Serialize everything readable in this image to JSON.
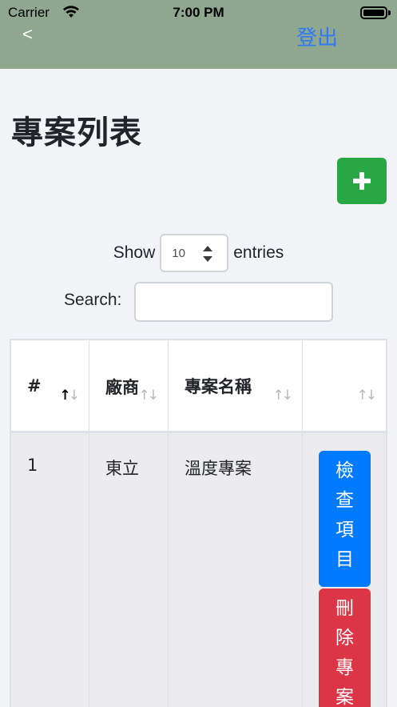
{
  "status_bar": {
    "carrier": "Carrier",
    "time": "7:00 PM"
  },
  "nav": {
    "back_label": "<",
    "logout_label": "登出"
  },
  "page": {
    "title": "專案列表"
  },
  "table_controls": {
    "show_label": "Show",
    "page_length": "10",
    "entries_label": "entries",
    "search_label": "Search:",
    "search_value": ""
  },
  "table": {
    "headers": [
      "#",
      "廠商",
      "專案名稱",
      ""
    ],
    "sort_symbol": "↑↓",
    "rows": [
      {
        "index": "1",
        "vendor": "東立",
        "project_name": "溫度專案",
        "check_label": "檢查項目",
        "delete_label": "刪除專案"
      }
    ]
  },
  "colors": {
    "nav_bg": "#8fa68f",
    "add_button": "#28a745",
    "check_button": "#007bff",
    "delete_button": "#dc3545",
    "link": "#2f7bf5"
  }
}
